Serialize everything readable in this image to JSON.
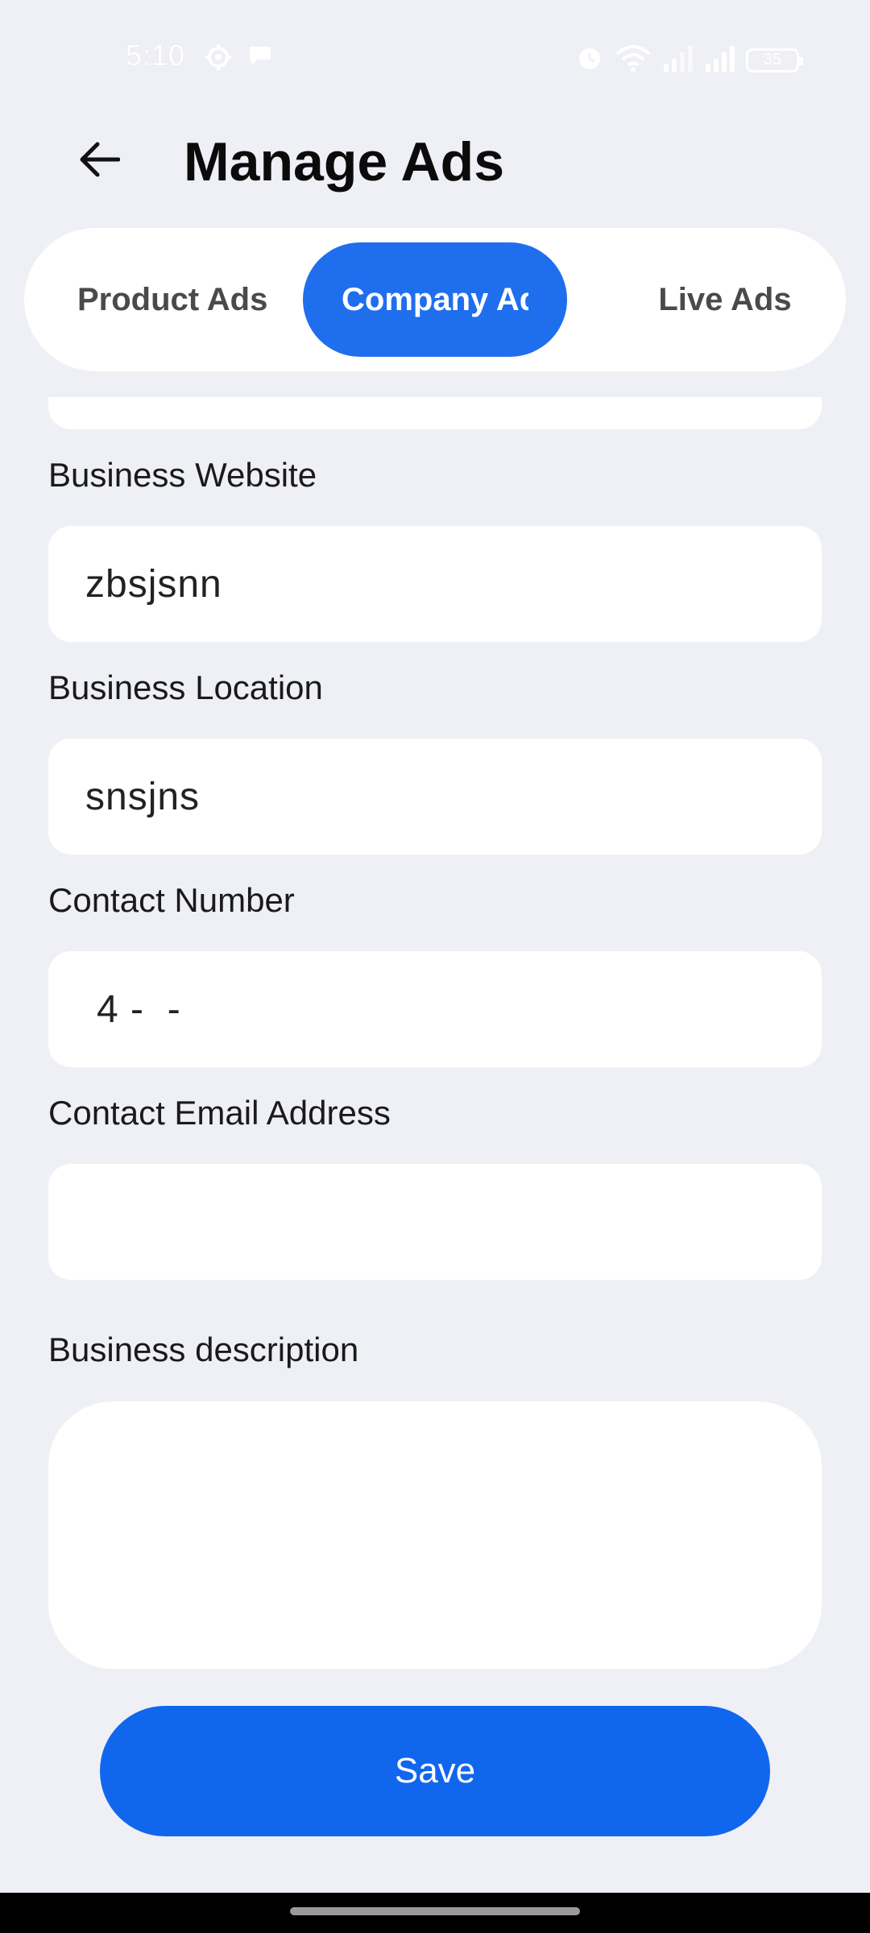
{
  "status_bar": {
    "time": "5:10",
    "battery": "35",
    "icons": [
      "settings-icon",
      "chat-icon",
      "alarm-icon",
      "wifi-icon",
      "signal-icon",
      "signal-icon",
      "battery-icon"
    ]
  },
  "header": {
    "title": "Manage Ads",
    "back_icon": "arrow-left-icon"
  },
  "tabs": [
    {
      "label": "Product Ads",
      "active": false
    },
    {
      "label": "Company Ads",
      "active": true
    },
    {
      "label": "Live Ads",
      "active": false
    }
  ],
  "form": {
    "business_website": {
      "label": "Business Website",
      "value": "zbsjsnn"
    },
    "business_location": {
      "label": "Business Location",
      "value": "snsjns"
    },
    "contact_number": {
      "label": "Contact Number",
      "value": "4 -  -"
    },
    "contact_email": {
      "label": "Contact Email Address",
      "value": ""
    },
    "business_description": {
      "label": "Business description",
      "value": ""
    }
  },
  "save_label": "Save",
  "colors": {
    "accent": "#1F6EEE",
    "background": "#EFF0F5",
    "save_button": "#1166EE"
  }
}
